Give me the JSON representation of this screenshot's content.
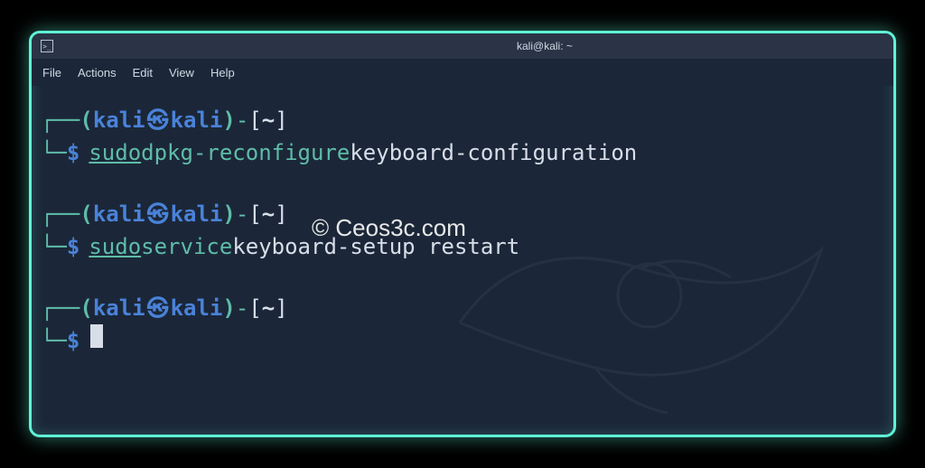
{
  "titlebar": {
    "icon_glyph": ">_",
    "title": "kali@kali: ~"
  },
  "menubar": {
    "items": [
      "File",
      "Actions",
      "Edit",
      "View",
      "Help"
    ]
  },
  "prompt": {
    "corner_tl": "┌──",
    "corner_bl": "└─",
    "paren_open": "(",
    "paren_close": ")",
    "user": "kali",
    "skull": "㉿",
    "host": "kali",
    "dash_br": "-",
    "bracket_open": "[",
    "bracket_close": "]",
    "path": "~",
    "dollar": "$"
  },
  "commands": [
    {
      "sudo": "sudo",
      "green": " dpkg-reconfigure",
      "plain": " keyboard-configuration"
    },
    {
      "sudo": "sudo",
      "green": " service",
      "plain": " keyboard-setup restart"
    }
  ],
  "watermark": "© Ceos3c.com"
}
